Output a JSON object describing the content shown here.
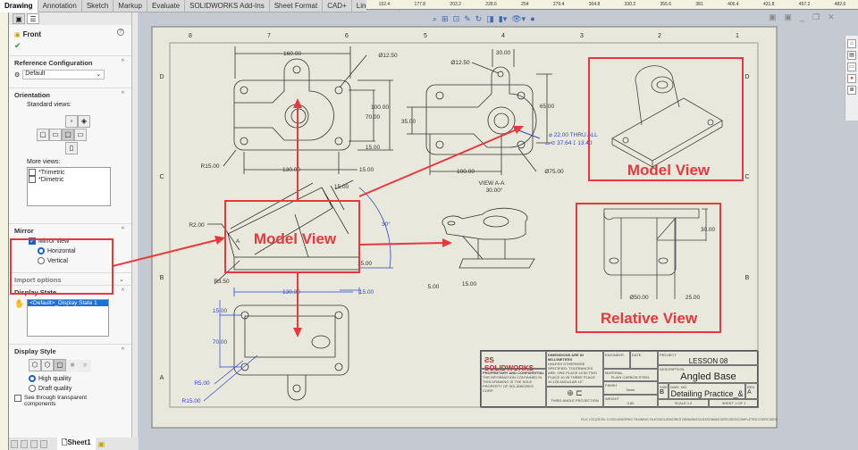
{
  "tabs": [
    "Drawing",
    "Annotation",
    "Sketch",
    "Markup",
    "Evaluate",
    "SOLIDWORKS Add-Ins",
    "Sheet Format",
    "CAD+",
    "Line Format"
  ],
  "ruler_top": [
    "152.4",
    "177.8",
    "203.2",
    "228.6",
    "254",
    "279.4",
    "304.8",
    "330.2",
    "355.6",
    "381",
    "406.4",
    "431.8",
    "457.2",
    "482.6"
  ],
  "panel": {
    "title": "Front",
    "help_icon": "?",
    "ok_icon": "✔",
    "ref_config": {
      "title": "Reference Configuration",
      "value": "Default"
    },
    "orientation": {
      "title": "Orientation",
      "standard_views": "Standard views:",
      "more_views": "More views:",
      "more_items": [
        "*Trimetric",
        "*Dimetric"
      ]
    },
    "mirror": {
      "title": "Mirror",
      "mirror_view": "Mirror view",
      "horizontal": "Horizontal",
      "vertical": "Vertical",
      "mirror_checked": true,
      "selected": "Horizontal"
    },
    "import_options": "Import options",
    "display_state": {
      "title": "Display State",
      "item": "<Default>_Display State 1"
    },
    "display_style": {
      "title": "Display Style",
      "high": "High quality",
      "draft": "Draft quality",
      "selected": "High quality",
      "see_through": "See through transparent components"
    }
  },
  "sheet_tab": "Sheet1",
  "drawing": {
    "zones_top": [
      "8",
      "7",
      "6",
      "5",
      "4",
      "3",
      "2",
      "1"
    ],
    "zones_side": [
      "D",
      "C",
      "B",
      "A"
    ],
    "front_view": {
      "d160": "160.00",
      "d_hole": "Ø12.50",
      "d100": "100.00",
      "d70": "70.00",
      "d15a": "15.00",
      "r15": "R15.00",
      "d130": "130.00",
      "d15b": "15.00"
    },
    "view_aa": {
      "d30": "30.00",
      "d_hole": "Ø12.50",
      "d65": "65.00",
      "d35": "35.00",
      "d100": "100.00",
      "d75": "Ø75.00",
      "callout1": "⌀ 22.00 THRU ALL",
      "callout2": "⌴ ⌀ 37.64 ↧ 13.40",
      "label": "VIEW A-A",
      "rotation": "30.00°"
    },
    "angled_view": {
      "r2": "R2.00",
      "arrow_label": "A",
      "d15": "15.00",
      "angle": "30°",
      "d15b": "15.00",
      "r35": "R3.50"
    },
    "bottom_view": {
      "d130": "130.00",
      "d15": "15.00",
      "d15v": "15.00",
      "d70": "70.00",
      "r5": "R5.00",
      "r15": "R15.00"
    },
    "section_view": {
      "d5": "5.00",
      "d15": "15.00"
    },
    "relative_view": {
      "d30": "30.00",
      "d50": "Ø50.00",
      "d25": "25.00"
    },
    "annotations": {
      "model_view_1": "Model View",
      "model_view_2": "Model View",
      "relative_view": "Relative View",
      "color": "#e8383d"
    },
    "title_block": {
      "logo": "SOLIDWORKS",
      "units": "DIMENSIONS ARE IN MILLIMETERS",
      "tol": "UNLESS OTHERWISE SPECIFIED: TOLERANCES ARE: ONE PLACE ±0.50 TWO PLACE ±0.25 THREE PLACE ±0.125 ANGULAR ±1°",
      "prop": "PROPRIETARY AND CONFIDENTIAL",
      "prop_text": "THE INFORMATION CONTAINED IN THIS DRAWING IS THE SOLE PROPERTY OF SOLIDWORKS CORP.",
      "projection": "THIRD ANGLE PROJECTION",
      "engineer": "ENGINEER",
      "date": "DATE",
      "material_label": "MATERIAL",
      "material": "PLAIN CARBON STEEL",
      "finish_label": "FINISH",
      "finish": "None",
      "weight_label": "WEIGHT",
      "weight": "0.80",
      "project_label": "PROJECT",
      "project": "LESSON 08",
      "desc_label": "DESCRIPTION",
      "desc": "Angled Base",
      "size_label": "SIZE",
      "size": "B",
      "dwg_label": "DWG. NO.",
      "dwg": "Detailing Practice_&",
      "rev_label": "REV.",
      "rev": "A",
      "scale": "SCALE:1:2",
      "sheet": "SHEET 1 OF 1"
    },
    "file_location": "FILE LOCATION: C:\\SOLIDWORKS TRAINING FILES\\SOLIDWORKS DRAWINGS\\LESSON08\\EXERCISES\\COMPLETED EXERCISES\\"
  }
}
